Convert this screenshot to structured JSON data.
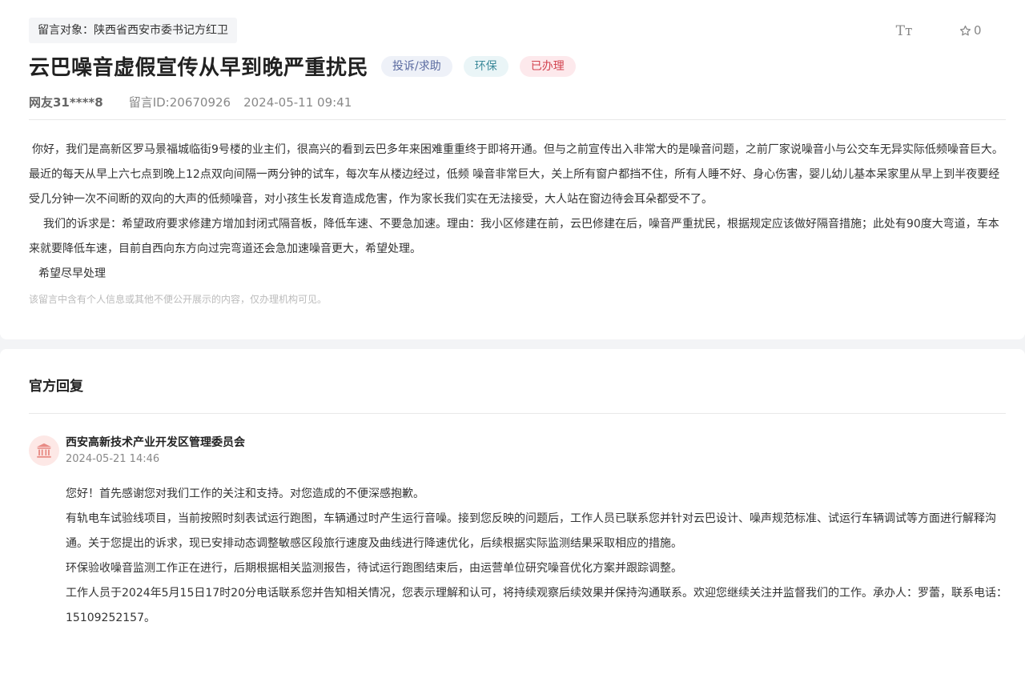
{
  "header": {
    "target": "留言对象：陕西省西安市委书记方红卫",
    "font_toggle": "Tт",
    "star_count": "0"
  },
  "post": {
    "title": "云巴噪音虚假宣传从早到晚严重扰民",
    "tags": [
      "投诉/求助",
      "环保",
      "已办理"
    ],
    "author": "网友31****8",
    "message_id": "留言ID:20670926",
    "datetime": "2024-05-11 09:41",
    "paragraphs": [
      "你好，我们是高新区罗马景福城临街9号楼的业主们，很高兴的看到云巴多年来困难重重终于即将开通。但与之前宣传出入非常大的是噪音问题，之前厂家说噪音小与公交车无异实际低频噪音巨大。最近的每天从早上六七点到晚上12点双向间隔一两分钟的试车，每次车从楼边经过，低频 噪音非常巨大，关上所有窗户都挡不住，所有人睡不好、身心伤害，婴儿幼儿基本呆家里从早上到半夜要经受几分钟一次不间断的双向的大声的低频噪音，对小孩生长发育造成危害，作为家长我们实在无法接受，大人站在窗边待会耳朵都受不了。",
      "我们的诉求是：希望政府要求修建方增加封闭式隔音板，降低车速、不要急加速。理由：我小区修建在前，云巴修建在后，噪音严重扰民，根据规定应该做好隔音措施；此处有90度大弯道，车本来就要降低车速，目前自西向东方向过完弯道还会急加速噪音更大，希望处理。",
      "希望尽早处理"
    ],
    "notice": "该留言中含有个人信息或其他不便公开展示的内容，仅办理机构可见。"
  },
  "reply": {
    "section_title": "官方回复",
    "org_name": "西安高新技术产业开发区管理委员会",
    "datetime": "2024-05-21 14:46",
    "paragraphs": [
      "您好！首先感谢您对我们工作的关注和支持。对您造成的不便深感抱歉。",
      "有轨电车试验线项目，当前按照时刻表试运行跑图，车辆通过时产生运行音噪。接到您反映的问题后，工作人员已联系您并针对云巴设计、噪声规范标准、试运行车辆调试等方面进行解释沟通。关于您提出的诉求，现已安排动态调整敏感区段旅行速度及曲线进行降速优化，后续根据实际监测结果采取相应的措施。",
      "环保验收噪音监测工作正在进行，后期根据相关监测报告，待试运行跑图结束后，由运营单位研究噪音优化方案并跟踪调整。",
      "工作人员于2024年5月15日17时20分电话联系您并告知相关情况，您表示理解和认可，将持续观察后续效果并保持沟通联系。欢迎您继续关注并监督我们的工作。承办人：罗蕾，联系电话：15109252157。"
    ]
  },
  "icons": {
    "font_size": "font-size-icon",
    "star": "star-icon",
    "org": "government-building-icon"
  },
  "colors": {
    "tag_done_text": "#d2434f",
    "tag_done_bg": "#fde9ec",
    "tag_env_text": "#3d8a9a",
    "tag_type_text": "#5a6aa0",
    "org_icon": "#e88a84"
  }
}
